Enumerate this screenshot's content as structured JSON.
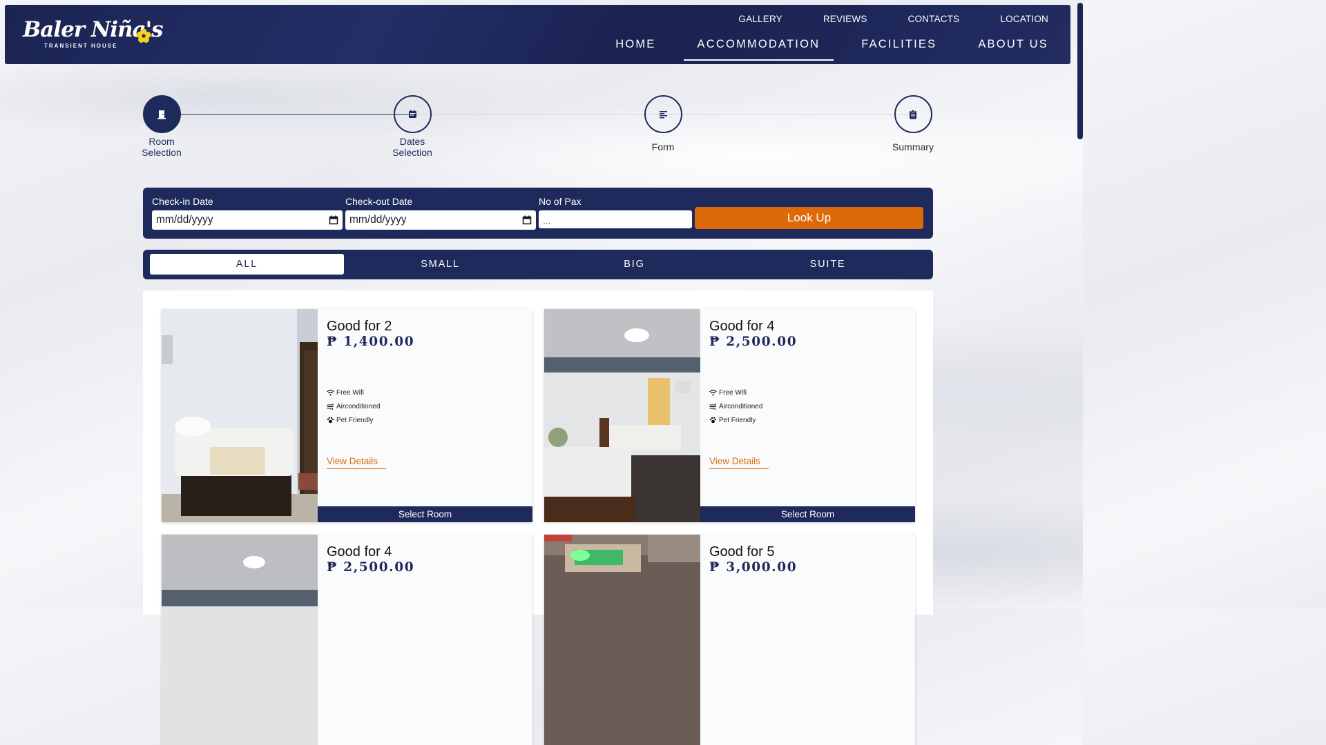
{
  "brand": {
    "name": "Baler Niña's",
    "tagline": "TRANSIENT HOUSE"
  },
  "nav": {
    "secondary": [
      "GALLERY",
      "REVIEWS",
      "CONTACTS",
      "LOCATION"
    ],
    "primary": [
      "HOME",
      "ACCOMMODATION",
      "FACILITIES",
      "ABOUT US"
    ],
    "active": "ACCOMMODATION"
  },
  "steps": [
    {
      "label": "Room Selection",
      "icon": "door-icon",
      "state": "current"
    },
    {
      "label": "Dates Selection",
      "icon": "calendar-icon",
      "state": "next"
    },
    {
      "label": "Form",
      "icon": "form-lines-icon",
      "state": "pending"
    },
    {
      "label": "Summary",
      "icon": "clipboard-icon",
      "state": "pending"
    }
  ],
  "search": {
    "checkin_label": "Check-in Date",
    "checkin_value": "mm/dd/yyyy",
    "checkout_label": "Check-out Date",
    "checkout_value": "mm/dd/yyyy",
    "pax_label": "No of Pax",
    "pax_placeholder": "...",
    "lookup_label": "Look Up"
  },
  "tabs": {
    "items": [
      "ALL",
      "SMALL",
      "BIG",
      "SUITE"
    ],
    "active": "ALL"
  },
  "rooms": [
    {
      "title": "Good for 2",
      "price": "₱ 1,400.00",
      "amenities": [
        "Free Wifi",
        "Airconditioned",
        "Pet Friendly"
      ],
      "details_label": "View Details",
      "select_label": "Select Room"
    },
    {
      "title": "Good for 4",
      "price": "₱ 2,500.00",
      "amenities": [
        "Free Wifi",
        "Airconditioned",
        "Pet Friendly"
      ],
      "details_label": "View Details",
      "select_label": "Select Room"
    },
    {
      "title": "Good for 4",
      "price": "₱ 2,500.00",
      "amenities": [],
      "details_label": "",
      "select_label": ""
    },
    {
      "title": "Good for 5",
      "price": "₱ 3,000.00",
      "amenities": [],
      "details_label": "",
      "select_label": ""
    }
  ],
  "colors": {
    "navy": "#1f2a5c",
    "accent_orange": "#dc6a0a",
    "flower_yellow": "#f3d21b"
  }
}
